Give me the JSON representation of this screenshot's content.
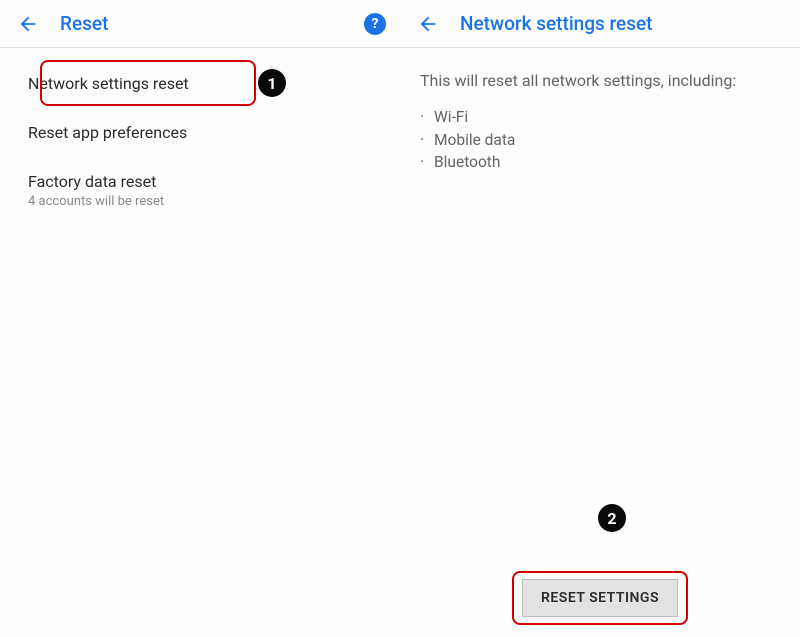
{
  "left": {
    "title": "Reset",
    "items": [
      {
        "label": "Network settings reset",
        "sub": ""
      },
      {
        "label": "Reset app preferences",
        "sub": ""
      },
      {
        "label": "Factory data reset",
        "sub": "4 accounts will be reset"
      }
    ]
  },
  "right": {
    "title": "Network settings reset",
    "description": "This will reset all network settings, including:",
    "bullets": [
      "Wi-Fi",
      "Mobile data",
      "Bluetooth"
    ],
    "button": "RESET SETTINGS"
  },
  "annotations": {
    "badge1": "1",
    "badge2": "2"
  },
  "colors": {
    "accent": "#1a73e8",
    "highlight": "#d40000"
  }
}
